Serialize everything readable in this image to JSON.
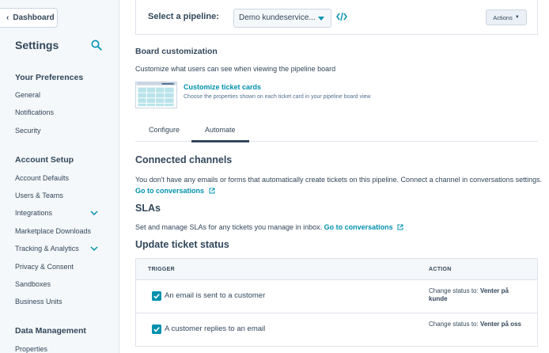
{
  "sidebar": {
    "dashboard_button": "Dashboard",
    "title": "Settings",
    "sections": [
      {
        "heading": "Your Preferences",
        "items": [
          "General",
          "Notifications",
          "Security"
        ]
      },
      {
        "heading": "Account Setup",
        "items": [
          "Account Defaults",
          "Users & Teams",
          "Integrations",
          "Marketplace Downloads",
          "Tracking & Analytics",
          "Privacy & Consent",
          "Sandboxes",
          "Business Units"
        ]
      },
      {
        "heading": "Data Management",
        "items": [
          "Properties"
        ]
      }
    ]
  },
  "pipeline": {
    "label": "Select a pipeline:",
    "selected": "Demo kundeservice...",
    "actions_label": "Actions"
  },
  "board": {
    "heading": "Board customization",
    "description": "Customize what users can see when viewing the pipeline board",
    "link_title": "Customize ticket cards",
    "link_description": "Choose the properties shown on each ticket card in your pipeline board view"
  },
  "tabs": [
    {
      "label": "Configure",
      "active": false
    },
    {
      "label": "Automate",
      "active": true
    }
  ],
  "connected_channels": {
    "heading": "Connected channels",
    "text": "You don't have any emails or forms that automatically create tickets on this pipeline. Connect a channel in conversations settings.",
    "link": "Go to conversations"
  },
  "slas": {
    "heading": "SLAs",
    "text": "Set and manage SLAs for any tickets you manage in inbox.",
    "link": "Go to conversations"
  },
  "ticket_status": {
    "heading": "Update ticket status",
    "columns": [
      "TRIGGER",
      "ACTION"
    ],
    "rows": [
      {
        "trigger": "An email is sent to a customer",
        "checked": true,
        "action_prefix": "Change status to:",
        "action_value": "Venter på kunde"
      },
      {
        "trigger": "A customer replies to an email",
        "checked": true,
        "action_prefix": "Change status to:",
        "action_value": "Venter på oss"
      }
    ]
  },
  "colors": {
    "accent": "#0091ae",
    "text": "#33475b",
    "sidebar_bg": "#f5f8fa",
    "border": "#dfe3eb"
  }
}
